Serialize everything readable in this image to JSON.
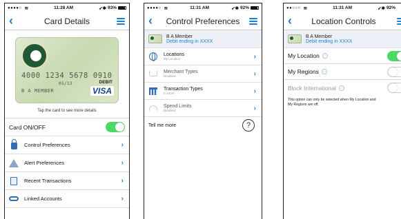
{
  "screens": [
    {
      "status": {
        "time": "11:28 AM",
        "battery": "93%"
      },
      "title": "Card Details",
      "card": {
        "number": "4000 1234 5678 0910",
        "expiry": "01/13",
        "name": "B A MEMBER",
        "type": "DEBIT",
        "brand": "VISA"
      },
      "hint": "Tap the card to see more details",
      "onoff_label": "Card ON/OFF",
      "rows": [
        {
          "label": "Control Preferences",
          "icon": "lock-icon"
        },
        {
          "label": "Alert Preferences",
          "icon": "warning-icon"
        },
        {
          "label": "Recent Transactions",
          "icon": "document-icon"
        },
        {
          "label": "Linked Accounts",
          "icon": "link-icon"
        }
      ]
    },
    {
      "status": {
        "time": "11:31 AM",
        "battery": "92%"
      },
      "title": "Control Preferences",
      "member": {
        "name": "B A Member",
        "sub": "Debit ending in XXXX"
      },
      "rows": [
        {
          "title": "Locations",
          "sub": "My Location",
          "icon": "globe-icon"
        },
        {
          "title": "Merchant Types",
          "sub": "Disabled",
          "icon": "cart-icon"
        },
        {
          "title": "Transaction Types",
          "sub": "In Store",
          "icon": "bank-icon"
        },
        {
          "title": "Spend Limits",
          "sub": "Disabled",
          "icon": "gauge-icon"
        }
      ],
      "tellme": "Tell me more",
      "help_glyph": "?"
    },
    {
      "status": {
        "time": "11:31 AM",
        "battery": "92%"
      },
      "title": "Location Controls",
      "member": {
        "name": "B A Member",
        "sub": "Debit ending in XXXX"
      },
      "rows": [
        {
          "label": "My Location",
          "on": true
        },
        {
          "label": "My Regions",
          "on": false
        },
        {
          "label": "Block International",
          "on": false
        }
      ],
      "note": "This option can only be selected when My Location and\nMy Regions are off."
    }
  ],
  "colors": {
    "accent": "#1a7fd6",
    "toggle_on": "#4cd964"
  }
}
